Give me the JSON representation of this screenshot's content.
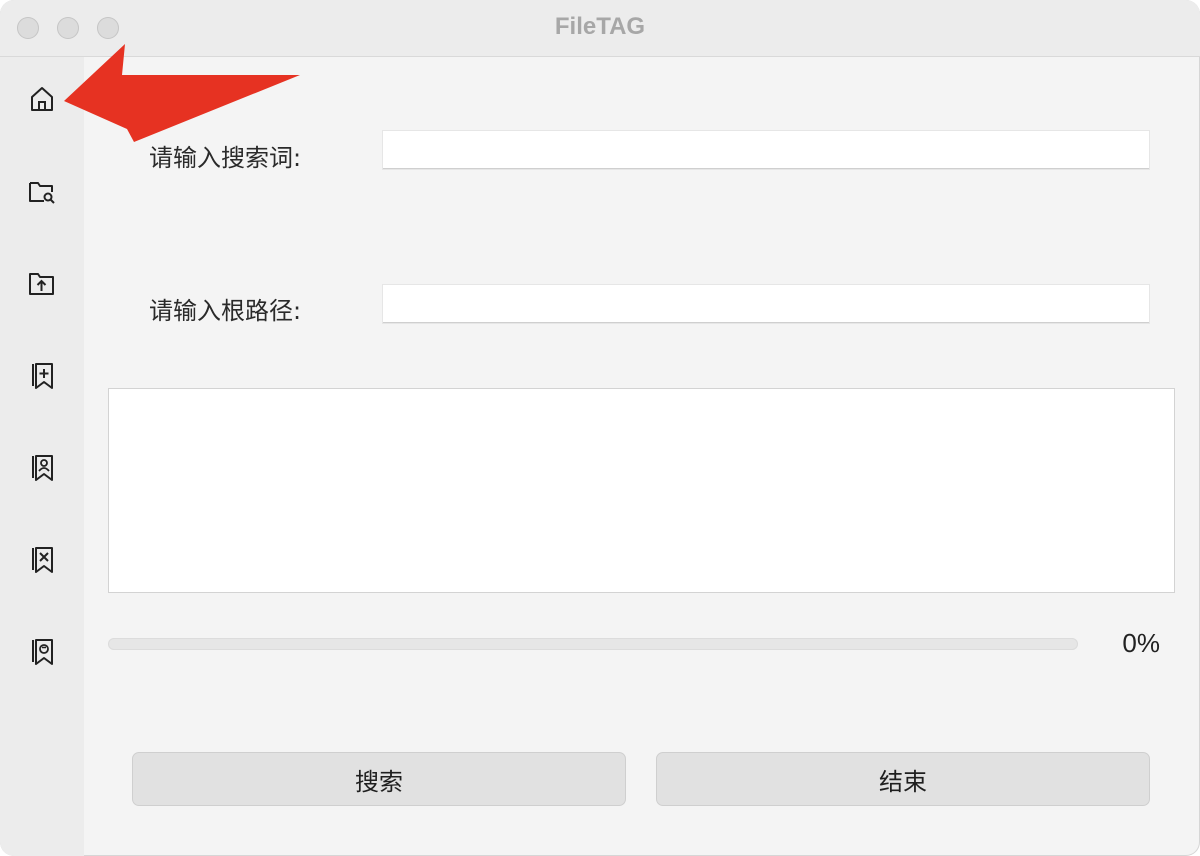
{
  "window": {
    "title": "FileTAG"
  },
  "sidebar": {
    "items": [
      {
        "icon": "home-icon"
      },
      {
        "icon": "folder-search-icon"
      },
      {
        "icon": "folder-upload-icon"
      },
      {
        "icon": "document-add-icon"
      },
      {
        "icon": "document-person-icon"
      },
      {
        "icon": "document-delete-icon"
      },
      {
        "icon": "document-tag-icon"
      }
    ]
  },
  "form": {
    "search_label": "请输入搜索词:",
    "search_value": "",
    "root_label": "请输入根路径:",
    "root_value": ""
  },
  "progress": {
    "value": 0,
    "text": "0%"
  },
  "buttons": {
    "search": "搜索",
    "end": "结束"
  },
  "annotation": {
    "color": "#e63222"
  }
}
